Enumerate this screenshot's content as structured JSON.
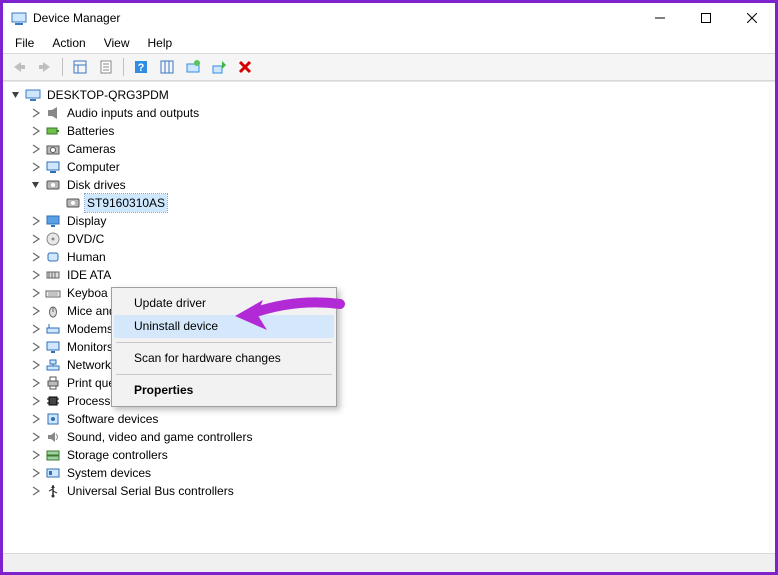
{
  "window": {
    "title": "Device Manager"
  },
  "menubar": {
    "file": "File",
    "action": "Action",
    "view": "View",
    "help": "Help"
  },
  "toolbar": {
    "back": "back-icon",
    "forward": "forward-icon",
    "show_hidden": "show-hidden-icon",
    "properties": "properties-icon",
    "help": "help-icon",
    "columns": "columns-icon",
    "enable": "enable-icon",
    "update": "update-driver-icon",
    "uninstall": "uninstall-icon"
  },
  "tree": {
    "root": {
      "label": "DESKTOP-QRG3PDM",
      "expanded": true
    },
    "categories": [
      {
        "label": "Audio inputs and outputs",
        "icon": "audio-icon",
        "expanded": false
      },
      {
        "label": "Batteries",
        "icon": "battery-icon",
        "expanded": false
      },
      {
        "label": "Cameras",
        "icon": "camera-icon",
        "expanded": false
      },
      {
        "label": "Computer",
        "icon": "computer-icon",
        "expanded": false
      },
      {
        "label": "Disk drives",
        "icon": "disk-icon",
        "expanded": true,
        "children": [
          {
            "label": "ST9160310AS",
            "icon": "disk-icon",
            "selected": true
          }
        ]
      },
      {
        "label": "Display adapters",
        "icon": "display-icon",
        "expanded": false,
        "truncated_label": "Display"
      },
      {
        "label": "DVD/CD-ROM drives",
        "icon": "dvd-icon",
        "expanded": false,
        "truncated_label": "DVD/C"
      },
      {
        "label": "Human Interface Devices",
        "icon": "hid-icon",
        "expanded": false,
        "truncated_label": "Human"
      },
      {
        "label": "IDE ATA/ATAPI controllers",
        "icon": "ide-icon",
        "expanded": false,
        "truncated_label": "IDE ATA"
      },
      {
        "label": "Keyboards",
        "icon": "keyboard-icon",
        "expanded": false,
        "truncated_label": "Keyboa"
      },
      {
        "label": "Mice and other pointing devices",
        "icon": "mouse-icon",
        "expanded": false
      },
      {
        "label": "Modems",
        "icon": "modem-icon",
        "expanded": false
      },
      {
        "label": "Monitors",
        "icon": "monitor-icon",
        "expanded": false
      },
      {
        "label": "Network adapters",
        "icon": "network-icon",
        "expanded": false
      },
      {
        "label": "Print queues",
        "icon": "print-icon",
        "expanded": false
      },
      {
        "label": "Processors",
        "icon": "cpu-icon",
        "expanded": false
      },
      {
        "label": "Software devices",
        "icon": "software-icon",
        "expanded": false
      },
      {
        "label": "Sound, video and game controllers",
        "icon": "sound-icon",
        "expanded": false
      },
      {
        "label": "Storage controllers",
        "icon": "storage-icon",
        "expanded": false
      },
      {
        "label": "System devices",
        "icon": "system-icon",
        "expanded": false
      },
      {
        "label": "Universal Serial Bus controllers",
        "icon": "usb-icon",
        "expanded": false
      }
    ]
  },
  "context_menu": {
    "items": [
      {
        "label": "Update driver",
        "kind": "item"
      },
      {
        "label": "Uninstall device",
        "kind": "item",
        "hover": true,
        "highlighted_by_arrow": true
      },
      {
        "kind": "sep"
      },
      {
        "label": "Scan for hardware changes",
        "kind": "item"
      },
      {
        "kind": "sep"
      },
      {
        "label": "Properties",
        "kind": "item",
        "bold": true
      }
    ]
  },
  "annotation": {
    "arrow_color": "#b22ad6"
  }
}
